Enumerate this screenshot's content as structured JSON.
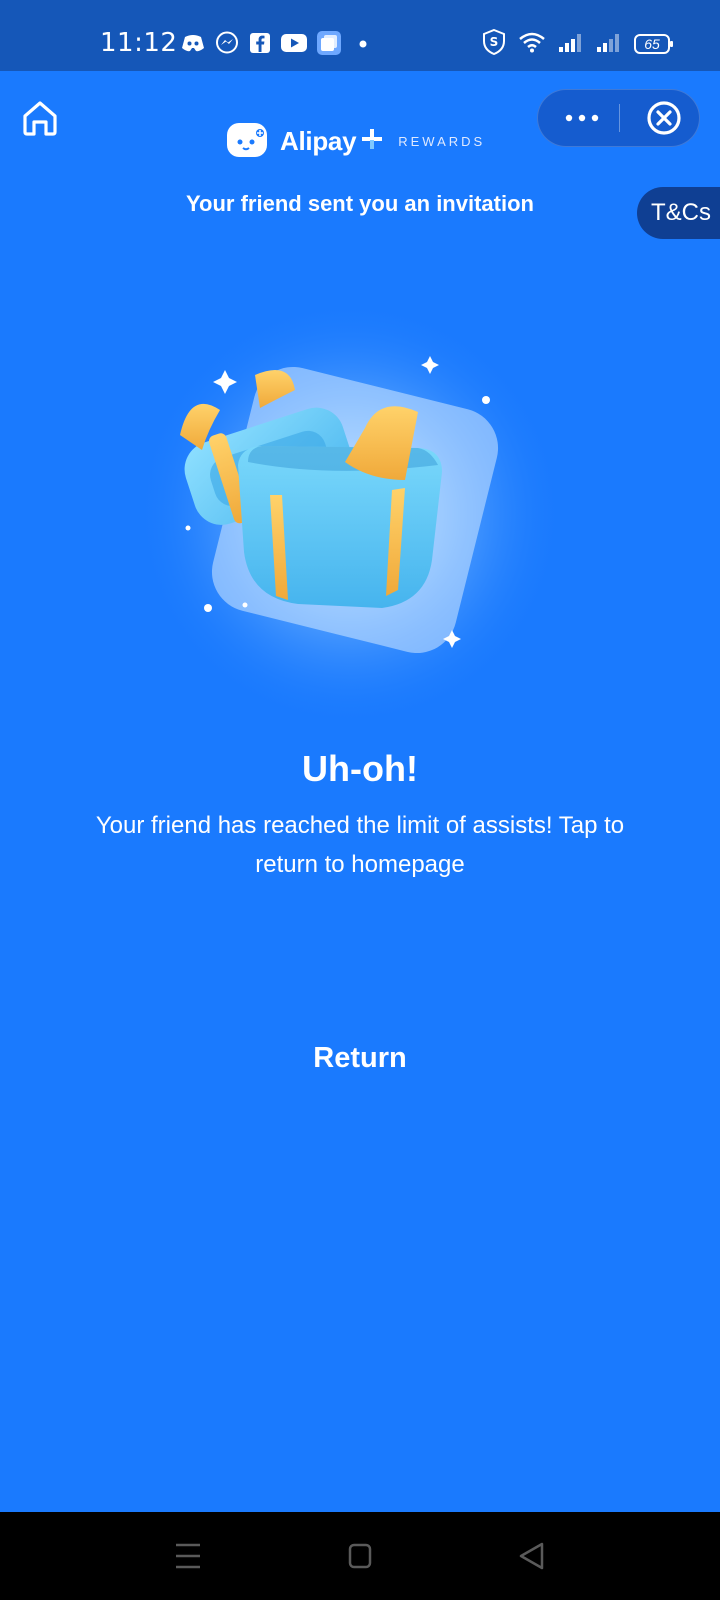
{
  "status_bar": {
    "time": "11:12",
    "notification_icons": [
      "discord-icon",
      "messenger-icon",
      "facebook-icon",
      "youtube-icon",
      "app-icon",
      "dot-icon"
    ],
    "system_icons": [
      "vpn-shield-icon",
      "wifi-icon",
      "signal-icon",
      "signal-icon"
    ],
    "battery": "65"
  },
  "header": {
    "brand_name": "Alipay",
    "brand_tag": "REWARDS",
    "invitation_text": "Your friend sent you an invitation",
    "tncs_label": "T&Cs"
  },
  "main": {
    "title": "Uh-oh!",
    "message": "Your friend has reached the limit of assists! Tap to return to homepage",
    "return_label": "Return"
  },
  "colors": {
    "background": "#1a7afe",
    "status_bar": "#1557b8",
    "capsule": "#155ccf",
    "tncs_tab": "#0f3f93",
    "gift_blue": "#5ccaf5",
    "ribbon": "#f5b547"
  }
}
